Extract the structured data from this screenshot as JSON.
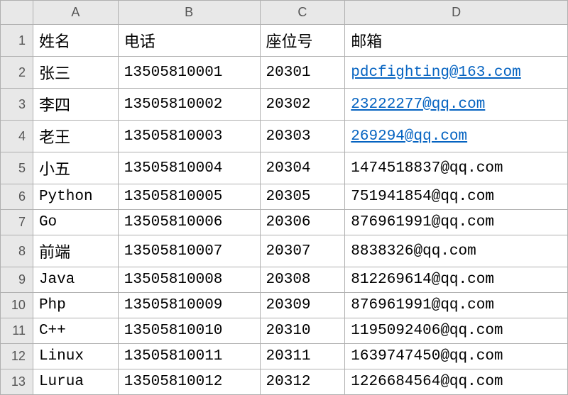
{
  "columns": [
    "A",
    "B",
    "C",
    "D"
  ],
  "rowNumbers": [
    "1",
    "2",
    "3",
    "4",
    "5",
    "6",
    "7",
    "8",
    "9",
    "10",
    "11",
    "12",
    "13"
  ],
  "headers": {
    "name": "姓名",
    "phone": "电话",
    "seat": "座位号",
    "email": "邮箱"
  },
  "rows": [
    {
      "name": "张三",
      "phone": "13505810001",
      "seat": "20301",
      "email": "pdcfighting@163.com",
      "link": true
    },
    {
      "name": "李四",
      "phone": "13505810002",
      "seat": "20302",
      "email": "23222277@qq.com",
      "link": true
    },
    {
      "name": "老王",
      "phone": "13505810003",
      "seat": "20303",
      "email": "269294@qq.com",
      "link": true
    },
    {
      "name": "小五",
      "phone": "13505810004",
      "seat": "20304",
      "email": "1474518837@qq.com",
      "link": false
    },
    {
      "name": "Python",
      "phone": "13505810005",
      "seat": "20305",
      "email": "751941854@qq.com",
      "link": false
    },
    {
      "name": "Go",
      "phone": "13505810006",
      "seat": "20306",
      "email": "876961991@qq.com",
      "link": false
    },
    {
      "name": "前端",
      "phone": "13505810007",
      "seat": "20307",
      "email": "8838326@qq.com",
      "link": false
    },
    {
      "name": "Java",
      "phone": "13505810008",
      "seat": "20308",
      "email": "812269614@qq.com",
      "link": false
    },
    {
      "name": "Php",
      "phone": "13505810009",
      "seat": "20309",
      "email": "876961991@qq.com",
      "link": false
    },
    {
      "name": "C++",
      "phone": "13505810010",
      "seat": "20310",
      "email": "1195092406@qq.com",
      "link": false
    },
    {
      "name": "Linux",
      "phone": "13505810011",
      "seat": "20311",
      "email": "1639747450@qq.com",
      "link": false
    },
    {
      "name": "Lurua",
      "phone": "13505810012",
      "seat": "20312",
      "email": "1226684564@qq.com",
      "link": false
    }
  ]
}
